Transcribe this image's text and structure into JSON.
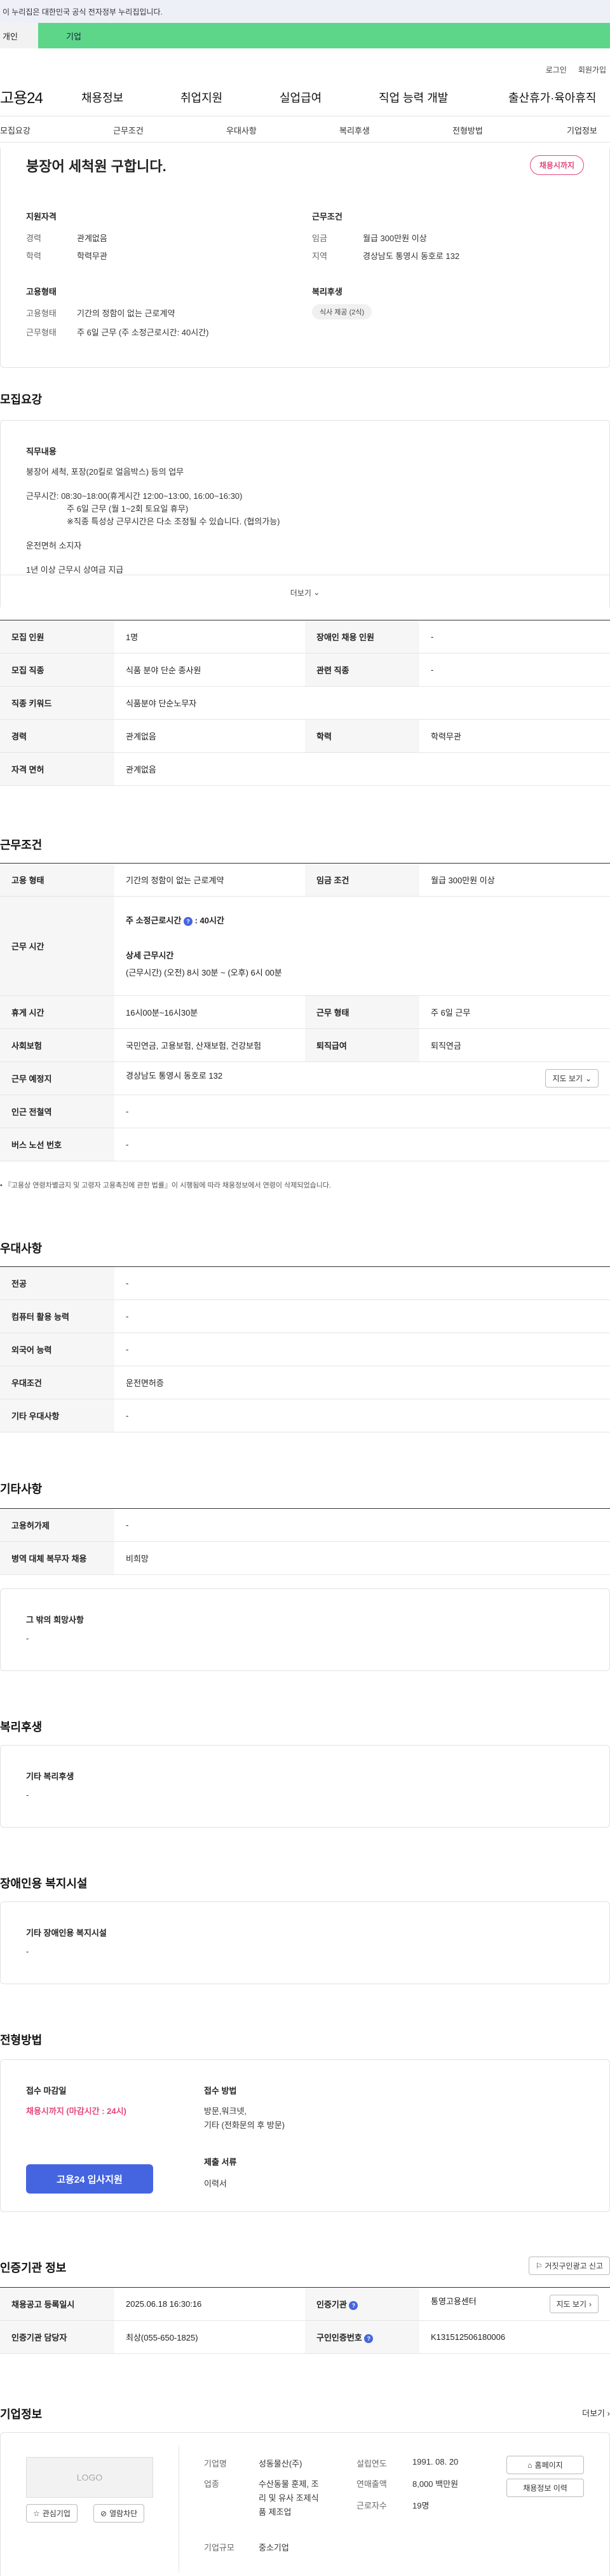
{
  "gov_banner": "이 누리집은 대한민국 공식 전자정부 누리집입니다.",
  "tabs": [
    "개인",
    "기업"
  ],
  "util_links": [
    "로그인",
    "회원가입"
  ],
  "logo": "고용24",
  "gnb": [
    "채용정보",
    "취업지원",
    "실업급여",
    "직업 능력 개발",
    "출산휴가·육아휴직"
  ],
  "subnav": [
    "모집요강",
    "근무조건",
    "우대사항",
    "복리후생",
    "전형방법",
    "기업정보"
  ],
  "summary": {
    "title": "붕장어 세척원 구합니다.",
    "deadline_badge": "채용시까지",
    "qual_title": "지원자격",
    "qual": [
      {
        "label": "경력",
        "value": "관계없음"
      },
      {
        "label": "학력",
        "value": "학력무관"
      }
    ],
    "cond_title": "근무조건",
    "cond": [
      {
        "label": "임금",
        "value": "월급 300만원 이상"
      },
      {
        "label": "지역",
        "value": "경상남도 통영시 동호로 132"
      }
    ],
    "emp_title": "고용형태",
    "emp": [
      {
        "label": "고용형태",
        "value": "기간의 정함이 없는 근로계약"
      },
      {
        "label": "근무형태",
        "value": "주 6일 근무 (주 소정근로시간: 40시간)"
      }
    ],
    "welfare_title": "복리후생",
    "welfare_chip": "식사 제공 (2식)"
  },
  "recruit": {
    "title": "모집요강",
    "duty_title": "직무내용",
    "duty_lines": [
      "붕장어 세척, 포장(20킬로 얼음박스) 등의 업무",
      "근무시간: 08:30~18:00(휴게시간 12:00~13:00, 16:00~16:30)",
      "주 6일 근무 (월 1~2회 토요일 휴무)",
      "※직종 특성상 근무시간은 다소 조정될 수 있습니다. (협의가능)",
      "운전면허 소지자",
      "1년 이상 근무시 상여금 지급"
    ],
    "more": "더보기",
    "table": [
      [
        "모집 인원",
        "1명",
        "장애인 채용 인원",
        "-"
      ],
      [
        "모집 직종",
        "식품 분야 단순 종사원",
        "관련 직종",
        "-"
      ],
      [
        "직종 키워드",
        "식품분야 단순노무자"
      ],
      [
        "경력",
        "관계없음",
        "학력",
        "학력무관"
      ],
      [
        "자격 면허",
        "관계없음"
      ]
    ]
  },
  "work": {
    "title": "근무조건",
    "emp_type_label": "고용 형태",
    "emp_type": "기간의 정함이 없는 근로계약",
    "wage_label": "임금 조건",
    "wage": "월급 300만원 이상",
    "hours_label": "근무 시간",
    "hours_weekly": "주 소정근로시간",
    "hours_weekly_val": ": 40시간",
    "hours_detail_title": "상세 근무시간",
    "hours_detail": "(근무시간) (오전) 8시 30분 ~ (오후) 6시 00분",
    "break_label": "휴게 시간",
    "break": "16시00분~16시30분",
    "form_label": "근무 형태",
    "form": "주 6일 근무",
    "ins_label": "사회보험",
    "ins": "국민연금, 고용보험, 산재보험, 건강보험",
    "sev_label": "퇴직급여",
    "sev": "퇴직연금",
    "place_label": "근무 예정지",
    "place": "경상남도 통영시 동호로 132",
    "map_btn": "지도 보기",
    "station_label": "인근 전철역",
    "station": "-",
    "bus_label": "버스 노선 번호",
    "bus": "-",
    "notice": "『고용상 연령차별금지 및 고령자 고용촉진에 관한 법률』이 시행됨에 따라 채용정보에서 연령이 삭제되었습니다."
  },
  "pref": {
    "title": "우대사항",
    "rows": [
      [
        "전공",
        "-"
      ],
      [
        "컴퓨터 활용 능력",
        "-"
      ],
      [
        "외국어 능력",
        "-"
      ],
      [
        "우대조건",
        "운전면허증"
      ],
      [
        "기타 우대사항",
        "-"
      ]
    ]
  },
  "etc": {
    "title": "기타사항",
    "rows": [
      [
        "고용허가제",
        "-"
      ],
      [
        "병역 대체 복무자 채용",
        "비희망"
      ]
    ],
    "other_title": "그 밖의 희망사항",
    "other": "-"
  },
  "welfare": {
    "title": "복리후생",
    "box_title": "기타 복리후생",
    "box_val": "-"
  },
  "disab": {
    "title": "장애인용 복지시설",
    "box_title": "기타 장애인용 복지시설",
    "box_val": "-"
  },
  "process": {
    "title": "전형방법",
    "deadline_title": "접수 마감일",
    "deadline": "채용시까지 (마감시간 : 24시)",
    "apply_btn": "고용24 입사지원",
    "method_title": "접수 방법",
    "method_lines": [
      "방문,워크넷,",
      "기타 (전화문의 후 방문)"
    ],
    "docs_title": "제출 서류",
    "docs": "이력서"
  },
  "agency": {
    "title": "인증기관 정보",
    "report_btn": "거짓구인광고 신고",
    "rows": [
      {
        "l1": "채용공고 등록일시",
        "v1": "2025.06.18 16:30:16",
        "l2": "인증기관",
        "v2": "통영고용센터"
      },
      {
        "l1": "인증기관 담당자",
        "v1": "최상(055-650-1825)",
        "l2": "구인인증번호",
        "v2": "K131512506180006"
      }
    ],
    "map_btn": "지도 보기"
  },
  "company": {
    "title": "기업정보",
    "more": "더보기",
    "logo_text": "LOGO",
    "interest_btn": "관심기업",
    "block_btn": "열람차단",
    "name_label": "기업명",
    "name": "성동물산(주)",
    "industry_label": "업종",
    "industry_lines": [
      "수산동물 훈제, 조",
      "리 및 유사 조제식",
      "품 제조업"
    ],
    "scale_label": "기업규모",
    "scale": "중소기업",
    "founded_label": "설립연도",
    "founded": "1991. 08. 20",
    "sales_label": "연매출액",
    "sales": "8,000 백만원",
    "staff_label": "근로자수",
    "staff": "19명",
    "homepage_btn": "홈페이지",
    "recruit_btn": "채용정보 이력"
  }
}
